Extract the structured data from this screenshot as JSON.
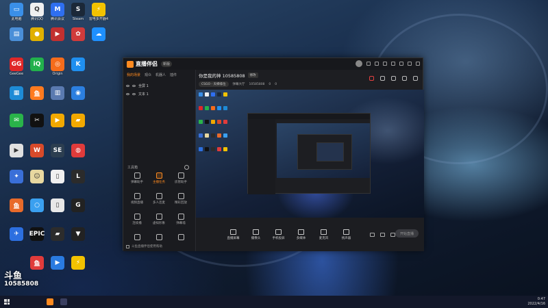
{
  "desktop": {
    "icons": [
      {
        "label": "此电脑",
        "color": "#3a8fe8",
        "glyph": "▭"
      },
      {
        "label": "腾讯QQ",
        "color": "#f0f0f0",
        "glyph": "Q"
      },
      {
        "label": "腾讯会议",
        "color": "#2f6ff0",
        "glyph": "M"
      },
      {
        "label": "Steam",
        "color": "#1b2838",
        "glyph": "S"
      },
      {
        "label": "雷电多开器4",
        "color": "#f2c200",
        "glyph": "⚡"
      },
      {
        "label": "",
        "color": "#4a8fd8",
        "glyph": "▤"
      },
      {
        "label": "",
        "color": "#e0b000",
        "glyph": "●"
      },
      {
        "label": "",
        "color": "#c23030",
        "glyph": "▶"
      },
      {
        "label": "",
        "color": "#d03b3b",
        "glyph": "✿"
      },
      {
        "label": "",
        "color": "#1e90ff",
        "glyph": "☁"
      },
      {
        "label": "GeeGee",
        "color": "#e02828",
        "glyph": "GG"
      },
      {
        "label": "",
        "color": "#22b14c",
        "glyph": "iQ"
      },
      {
        "label": "Origin",
        "color": "#f56c1b",
        "glyph": "◎"
      },
      {
        "label": "",
        "color": "#1f8ff0",
        "glyph": "K"
      },
      {
        "label": "",
        "color": "#1e8bd6",
        "glyph": "▦"
      },
      {
        "label": "",
        "color": "#ff7a1f",
        "glyph": "鱼"
      },
      {
        "label": "",
        "color": "#5a7ab0",
        "glyph": "▥"
      },
      {
        "label": "",
        "color": "#2c7fe0",
        "glyph": "◉"
      },
      {
        "label": "",
        "color": "#2ab34a",
        "glyph": "✉"
      },
      {
        "label": "",
        "color": "#111",
        "glyph": "✂"
      },
      {
        "label": "",
        "color": "#f2a900",
        "glyph": "▶"
      },
      {
        "label": "",
        "color": "#f2a900",
        "glyph": "▰"
      },
      {
        "label": "",
        "color": "#e0e0e0",
        "glyph": "▶"
      },
      {
        "label": "",
        "color": "#d84a2a",
        "glyph": "W"
      },
      {
        "label": "",
        "color": "#2c3e50",
        "glyph": "SE"
      },
      {
        "label": "",
        "color": "#e03b3b",
        "glyph": "◍"
      },
      {
        "label": "",
        "color": "#3a6fd8",
        "glyph": "✦"
      },
      {
        "label": "",
        "color": "#e8d8a0",
        "glyph": "☺"
      },
      {
        "label": "",
        "color": "#f0f0f0",
        "glyph": "▯"
      },
      {
        "label": "",
        "color": "#2b2b2b",
        "glyph": "L"
      },
      {
        "label": "",
        "color": "#e86a2a",
        "glyph": "鱼"
      },
      {
        "label": "",
        "color": "#3aa0f0",
        "glyph": "○"
      },
      {
        "label": "",
        "color": "#e8e8e8",
        "glyph": "▯"
      },
      {
        "label": "",
        "color": "#222",
        "glyph": "G"
      },
      {
        "label": "",
        "color": "#2c6fe0",
        "glyph": "✈"
      },
      {
        "label": "",
        "color": "#111",
        "glyph": "EPIC"
      },
      {
        "label": "",
        "color": "#2c2c2c",
        "glyph": "▰"
      },
      {
        "label": "",
        "color": "#222",
        "glyph": "▼"
      },
      {
        "label": "",
        "color": "#e03b3b",
        "glyph": "鱼"
      },
      {
        "label": "",
        "color": "#2a7be0",
        "glyph": "▶"
      },
      {
        "label": "",
        "color": "#f2c200",
        "glyph": "⚡"
      }
    ]
  },
  "watermark": {
    "logo": "斗鱼",
    "number": "10585808"
  },
  "app": {
    "title": "直播伴侣",
    "version_badge": "新版",
    "sidebar": {
      "tabs": [
        "我的场景",
        "观众",
        "机器人",
        "插件"
      ],
      "scenes": [
        "全屏 1",
        "文本 1"
      ],
      "tools_header": "工具箱",
      "tools": [
        "弹幕助手",
        "主播任务",
        "房管助手",
        "视频直播",
        "多人连麦",
        "精彩回放",
        "连续播",
        "虚拟形象",
        "弹幕墙",
        "",
        "",
        ""
      ],
      "bottom_note": "斗鱼直播伴侣使用帮助"
    },
    "room": {
      "title": "你是我的神 10585808",
      "edit_label": "修改",
      "category": "CSGO - 天梯排位",
      "meta": [
        "弹幕大厅",
        "10585808",
        "0",
        "0"
      ]
    },
    "controls": [
      "直播屏幕",
      "摄像头",
      "手机投屏",
      "多媒体",
      "麦克风",
      "扬声器"
    ],
    "start_label": "开始直播"
  },
  "taskbar": {
    "time": "0:47",
    "date": "2022/4/16"
  }
}
